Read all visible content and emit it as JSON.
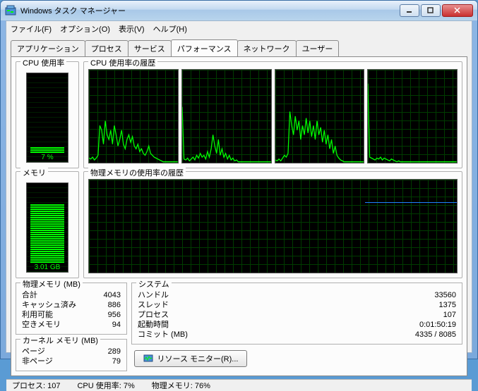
{
  "window": {
    "title": "Windows タスク マネージャー"
  },
  "menu": {
    "file": "ファイル(F)",
    "options": "オプション(O)",
    "view": "表示(V)",
    "help": "ヘルプ(H)"
  },
  "tabs": {
    "applications": "アプリケーション",
    "processes": "プロセス",
    "services": "サービス",
    "performance": "パフォーマンス",
    "networking": "ネットワーク",
    "users": "ユーザー"
  },
  "perf": {
    "cpu_usage_title": "CPU 使用率",
    "cpu_history_title": "CPU 使用率の履歴",
    "mem_title": "メモリ",
    "mem_history_title": "物理メモリの使用率の履歴",
    "cpu_value": "7 %",
    "cpu_fill_pct": 7,
    "mem_value": "3.01 GB",
    "mem_fill_pct": 76
  },
  "phys_mem": {
    "title": "物理メモリ (MB)",
    "total_k": "合計",
    "total_v": "4043",
    "cached_k": "キャッシュ済み",
    "cached_v": "886",
    "avail_k": "利用可能",
    "avail_v": "956",
    "free_k": "空きメモリ",
    "free_v": "94"
  },
  "kernel_mem": {
    "title": "カーネル メモリ (MB)",
    "paged_k": "ページ",
    "paged_v": "289",
    "nonpaged_k": "非ページ",
    "nonpaged_v": "79"
  },
  "system": {
    "title": "システム",
    "handles_k": "ハンドル",
    "handles_v": "33560",
    "threads_k": "スレッド",
    "threads_v": "1375",
    "procs_k": "プロセス",
    "procs_v": "107",
    "uptime_k": "起動時間",
    "uptime_v": "0:01:50:19",
    "commit_k": "コミット (MB)",
    "commit_v": "4335 / 8085"
  },
  "resource_btn": "リソース モニター(R)...",
  "status": {
    "processes": "プロセス: 107",
    "cpu": "CPU 使用率: 7%",
    "mem": "物理メモリ: 76%"
  },
  "chart_data": [
    {
      "type": "line",
      "title": "CPU core 0",
      "ylim": [
        0,
        100
      ],
      "values": [
        5,
        4,
        6,
        3,
        5,
        8,
        40,
        35,
        20,
        45,
        30,
        25,
        35,
        20,
        40,
        30,
        18,
        25,
        35,
        20,
        15,
        25,
        30,
        22,
        28,
        18,
        15,
        20,
        12,
        15,
        10,
        8,
        12,
        18,
        10,
        8,
        6,
        5,
        4,
        3,
        2,
        1,
        1,
        1,
        1,
        1,
        1,
        1,
        1,
        1
      ]
    },
    {
      "type": "line",
      "title": "CPU core 1",
      "ylim": [
        0,
        100
      ],
      "values": [
        60,
        4,
        3,
        5,
        2,
        4,
        6,
        3,
        8,
        5,
        10,
        6,
        8,
        4,
        12,
        6,
        15,
        30,
        18,
        10,
        25,
        8,
        15,
        6,
        10,
        4,
        8,
        3,
        5,
        2,
        3,
        1,
        1,
        1,
        1,
        1,
        1,
        1,
        1,
        1,
        1,
        1,
        1,
        1,
        1,
        1,
        1,
        1,
        1,
        1
      ]
    },
    {
      "type": "line",
      "title": "CPU core 2",
      "ylim": [
        0,
        100
      ],
      "values": [
        3,
        2,
        4,
        2,
        5,
        8,
        6,
        10,
        55,
        40,
        30,
        50,
        35,
        45,
        25,
        40,
        30,
        48,
        32,
        45,
        28,
        40,
        25,
        45,
        30,
        38,
        22,
        35,
        20,
        30,
        15,
        25,
        10,
        18,
        8,
        5,
        3,
        2,
        1,
        1,
        1,
        1,
        1,
        1,
        1,
        1,
        1,
        1,
        1,
        1
      ]
    },
    {
      "type": "line",
      "title": "CPU core 3",
      "ylim": [
        0,
        100
      ],
      "values": [
        85,
        6,
        5,
        4,
        3,
        5,
        4,
        6,
        3,
        5,
        4,
        3,
        2,
        4,
        3,
        2,
        1,
        2,
        1,
        1,
        1,
        1,
        1,
        1,
        1,
        1,
        1,
        1,
        1,
        1,
        1,
        1,
        1,
        1,
        1,
        1,
        1,
        1,
        1,
        1,
        1,
        1,
        1,
        1,
        1,
        1,
        1,
        1,
        1,
        1
      ]
    },
    {
      "type": "line",
      "title": "Physical Memory %",
      "ylim": [
        0,
        100
      ],
      "values": [
        76,
        76,
        76,
        76,
        76,
        76,
        76,
        76,
        76,
        76,
        76,
        76,
        76,
        76,
        76,
        76,
        76,
        76,
        76,
        76,
        76,
        76,
        76,
        76,
        76,
        76,
        76,
        76,
        76,
        76,
        76,
        76,
        76,
        76,
        76,
        76,
        76,
        76,
        76,
        76
      ]
    }
  ]
}
